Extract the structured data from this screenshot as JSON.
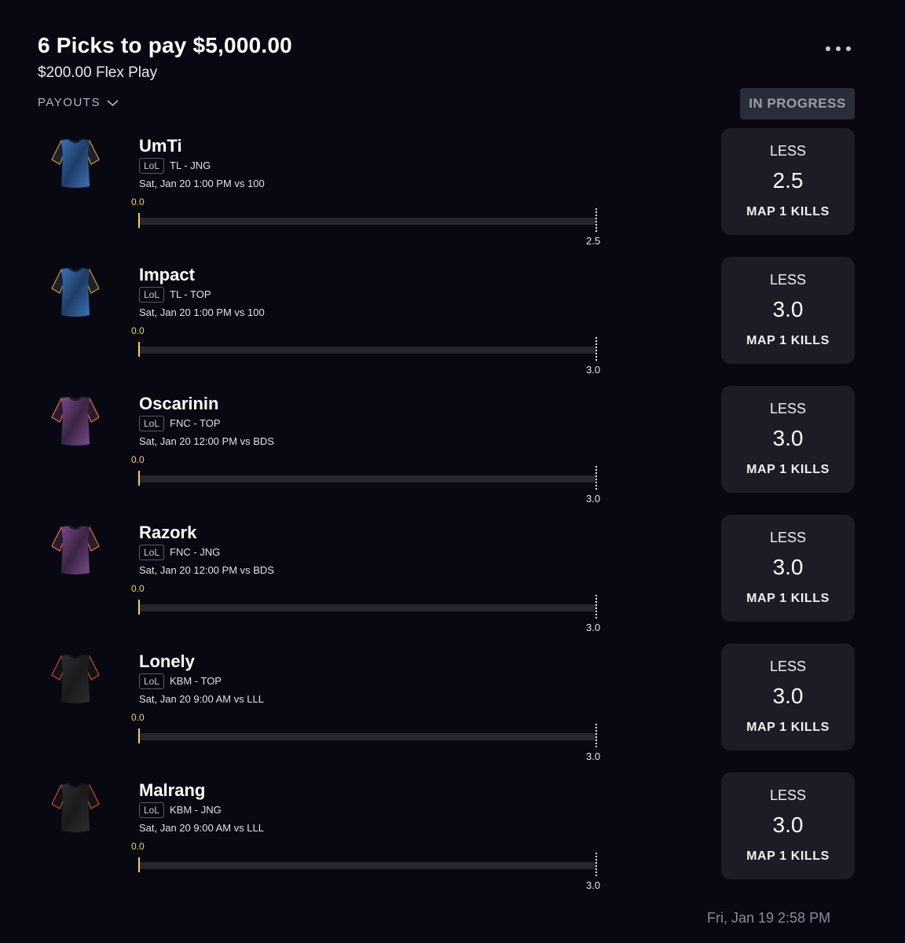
{
  "header": {
    "title": "6 Picks to pay $5,000.00",
    "subtitle": "$200.00 Flex Play",
    "payouts_label": "PAYOUTS",
    "status": "IN PROGRESS"
  },
  "colors": {
    "background": "#070812",
    "card": "#1b1c26",
    "accent_yellow": "#f2d24b",
    "status_badge": "#2a2c37"
  },
  "picks": [
    {
      "player": "UmTi",
      "league": "LoL",
      "team_pos": "TL - JNG",
      "game_time": "Sat, Jan 20 1:00 PM  vs 100",
      "current": "0.0",
      "line": "2.5",
      "progress": 0,
      "direction": "LESS",
      "stat": "MAP 1 KILLS",
      "jersey": "tl-jersey-icon"
    },
    {
      "player": "Impact",
      "league": "LoL",
      "team_pos": "TL - TOP",
      "game_time": "Sat, Jan 20 1:00 PM  vs 100",
      "current": "0.0",
      "line": "3.0",
      "progress": 0,
      "direction": "LESS",
      "stat": "MAP 1 KILLS",
      "jersey": "tl-jersey-icon"
    },
    {
      "player": "Oscarinin",
      "league": "LoL",
      "team_pos": "FNC - TOP",
      "game_time": "Sat, Jan 20 12:00 PM  vs BDS",
      "current": "0.0",
      "line": "3.0",
      "progress": 0,
      "direction": "LESS",
      "stat": "MAP 1 KILLS",
      "jersey": "fnc-jersey-icon"
    },
    {
      "player": "Razork",
      "league": "LoL",
      "team_pos": "FNC - JNG",
      "game_time": "Sat, Jan 20 12:00 PM  vs BDS",
      "current": "0.0",
      "line": "3.0",
      "progress": 0,
      "direction": "LESS",
      "stat": "MAP 1 KILLS",
      "jersey": "fnc-jersey-icon"
    },
    {
      "player": "Lonely",
      "league": "LoL",
      "team_pos": "KBM - TOP",
      "game_time": "Sat, Jan 20 9:00 AM  vs LLL",
      "current": "0.0",
      "line": "3.0",
      "progress": 0,
      "direction": "LESS",
      "stat": "MAP 1 KILLS",
      "jersey": "kbm-jersey-icon"
    },
    {
      "player": "Malrang",
      "league": "LoL",
      "team_pos": "KBM - JNG",
      "game_time": "Sat, Jan 20 9:00 AM  vs LLL",
      "current": "0.0",
      "line": "3.0",
      "progress": 0,
      "direction": "LESS",
      "stat": "MAP 1 KILLS",
      "jersey": "kbm-jersey-icon"
    }
  ],
  "footer": {
    "timestamp": "Fri, Jan 19 2:58 PM"
  }
}
